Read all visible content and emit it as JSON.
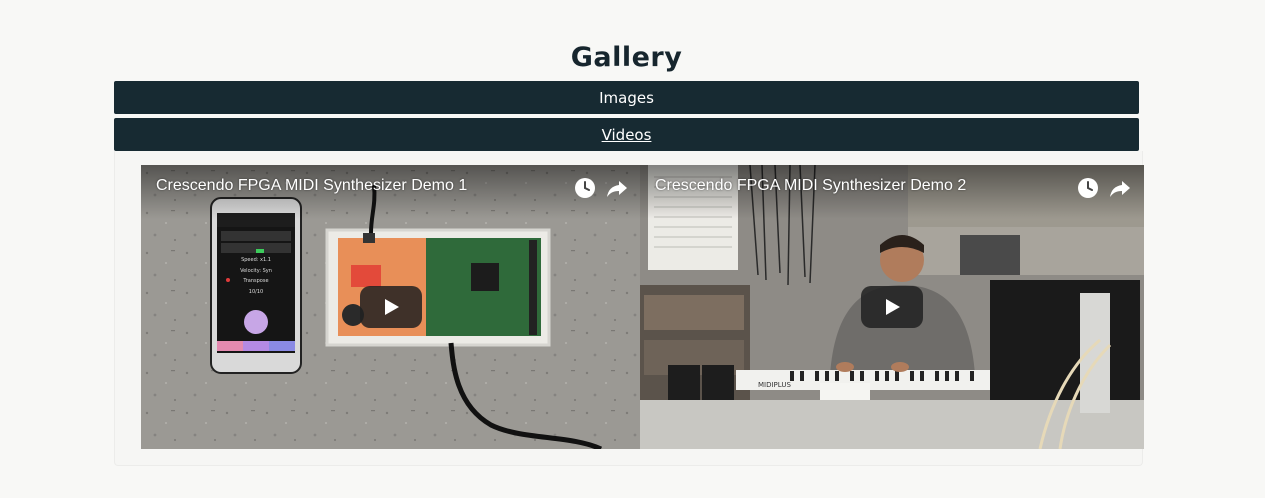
{
  "gallery": {
    "title": "Gallery",
    "tabs": [
      {
        "label": "Images"
      },
      {
        "label": "Videos"
      }
    ]
  },
  "videos": [
    {
      "title": "Crescendo FPGA MIDI Synthesizer Demo 1",
      "phone": {
        "speed_label": "Speed: x1.1",
        "velocity_label": "Velocity: Syn",
        "transpose_label": "Transpose",
        "counter": "10/10"
      },
      "icons": [
        "clock-icon",
        "share-icon",
        "play-icon"
      ]
    },
    {
      "title": "Crescendo FPGA MIDI Synthesizer Demo 2",
      "keyboard_brand": "MIDIPLUS",
      "icons": [
        "clock-icon",
        "share-icon",
        "play-icon"
      ]
    }
  ],
  "colors": {
    "tab_background": "#172a32",
    "page_background": "#f8f8f6",
    "title_color": "#17262e"
  }
}
